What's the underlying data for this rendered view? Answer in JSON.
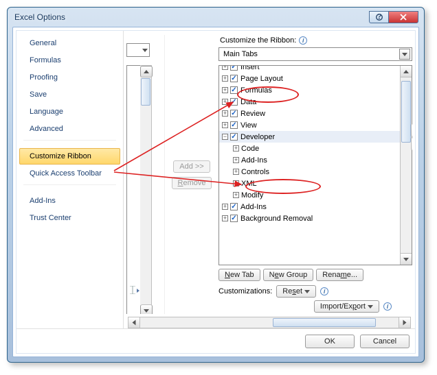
{
  "window": {
    "title": "Excel Options"
  },
  "sidebar": {
    "items": [
      {
        "label": "General"
      },
      {
        "label": "Formulas"
      },
      {
        "label": "Proofing"
      },
      {
        "label": "Save"
      },
      {
        "label": "Language"
      },
      {
        "label": "Advanced"
      },
      {
        "label": "Customize Ribbon",
        "selected": true
      },
      {
        "label": "Quick Access Toolbar"
      },
      {
        "label": "Add-Ins"
      },
      {
        "label": "Trust Center"
      }
    ]
  },
  "mid_buttons": {
    "add": "Add >>",
    "remove": "<< Remove"
  },
  "right": {
    "section_label": "Customize the Ribbon:",
    "combo_value": "Main Tabs",
    "tree": [
      {
        "level": 0,
        "exp": "+",
        "check": true,
        "label": "Insert",
        "cut": true
      },
      {
        "level": 0,
        "exp": "+",
        "check": true,
        "label": "Page Layout"
      },
      {
        "level": 0,
        "exp": "+",
        "check": true,
        "label": "Formulas"
      },
      {
        "level": 0,
        "exp": "+",
        "check": true,
        "label": "Data"
      },
      {
        "level": 0,
        "exp": "+",
        "check": true,
        "label": "Review"
      },
      {
        "level": 0,
        "exp": "+",
        "check": true,
        "label": "View"
      },
      {
        "level": 0,
        "exp": "−",
        "check": true,
        "label": "Developer",
        "selected": true
      },
      {
        "level": 1,
        "exp": "+",
        "label": "Code"
      },
      {
        "level": 1,
        "exp": "+",
        "label": "Add-Ins"
      },
      {
        "level": 1,
        "exp": "+",
        "label": "Controls"
      },
      {
        "level": 1,
        "exp": "+",
        "label": "XML"
      },
      {
        "level": 1,
        "exp": "+",
        "label": "Modify"
      },
      {
        "level": 0,
        "exp": "+",
        "check": true,
        "label": "Add-Ins"
      },
      {
        "level": 0,
        "exp": "+",
        "check": true,
        "label": "Background Removal",
        "cutbottom": true
      }
    ],
    "buttons": {
      "new_tab": "New Tab",
      "new_group": "New Group",
      "rename": "Rename..."
    },
    "customizations_label": "Customizations:",
    "reset": "Reset",
    "import_export": "Import/Export"
  },
  "footer": {
    "ok": "OK",
    "cancel": "Cancel"
  }
}
